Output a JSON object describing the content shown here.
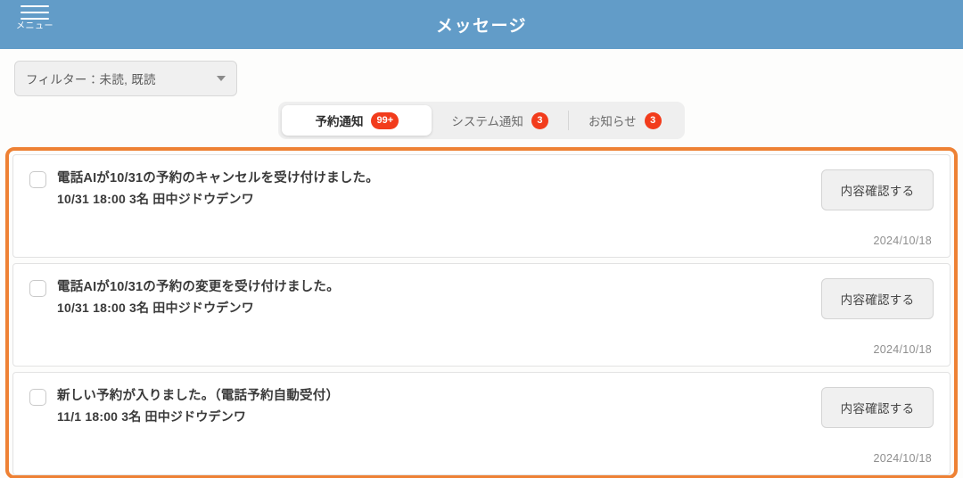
{
  "header": {
    "title": "メッセージ",
    "menu_label": "メニュー",
    "menu_icon": "hamburger-icon",
    "background_color": "#629cc8"
  },
  "filter": {
    "label": "フィルター：未読, 既読",
    "caret_icon": "chevron-down-icon"
  },
  "tabs": [
    {
      "label": "予約通知",
      "badge": "99+",
      "active": true
    },
    {
      "label": "システム通知",
      "badge": "3",
      "active": false
    },
    {
      "label": "お知らせ",
      "badge": "3",
      "active": false
    }
  ],
  "colors": {
    "accent_orange": "#ee8134",
    "badge_red": "#f23c1c",
    "header_blue": "#629cc8"
  },
  "messages": [
    {
      "title": "電話AIが10/31の予約のキャンセルを受け付けました。",
      "subtitle": "10/31 18:00 3名 田中ジドウデンワ",
      "button_label": "内容確認する",
      "date": "2024/10/18",
      "checked": false
    },
    {
      "title": "電話AIが10/31の予約の変更を受け付けました。",
      "subtitle": "10/31 18:00 3名 田中ジドウデンワ",
      "button_label": "内容確認する",
      "date": "2024/10/18",
      "checked": false
    },
    {
      "title": "新しい予約が入りました。（電話予約自動受付）",
      "subtitle": "11/1 18:00 3名 田中ジドウデンワ",
      "button_label": "内容確認する",
      "date": "2024/10/18",
      "checked": false
    }
  ]
}
